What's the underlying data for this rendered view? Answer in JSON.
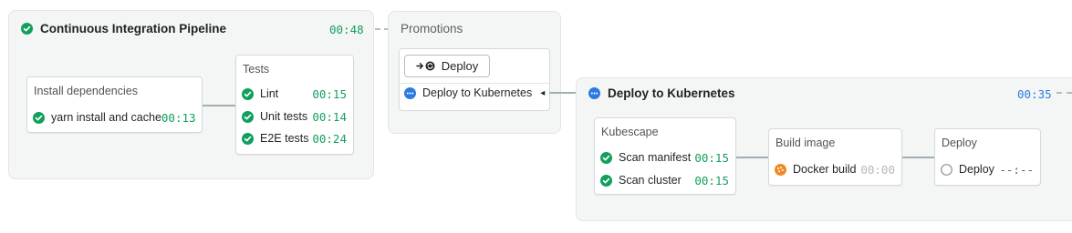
{
  "ci": {
    "title": "Continuous Integration Pipeline",
    "time": "00:48",
    "status_icon": "check-circle-icon",
    "blocks": {
      "install": {
        "title": "Install dependencies",
        "jobs": [
          {
            "name": "yarn install and cache",
            "time": "00:13"
          }
        ]
      },
      "tests": {
        "title": "Tests",
        "jobs": [
          {
            "name": "Lint",
            "time": "00:15"
          },
          {
            "name": "Unit tests",
            "time": "00:14"
          },
          {
            "name": "E2E tests",
            "time": "00:24"
          }
        ]
      }
    }
  },
  "promotions": {
    "title": "Promotions",
    "button_label": "Deploy",
    "target_label": "Deploy to Kubernetes",
    "arrow_glyph": "◂"
  },
  "deploy": {
    "title": "Deploy to Kubernetes",
    "time": "00:35",
    "status_icon": "running-circle-icon",
    "blocks": {
      "kubescape": {
        "title": "Kubescape",
        "jobs": [
          {
            "name": "Scan manifest",
            "time": "00:15"
          },
          {
            "name": "Scan cluster",
            "time": "00:15"
          }
        ]
      },
      "build": {
        "title": "Build image",
        "jobs": [
          {
            "name": "Docker build",
            "time": "00:00"
          }
        ]
      },
      "deployblock": {
        "title": "Deploy",
        "jobs": [
          {
            "name": "Deploy",
            "time": "--:--"
          }
        ]
      }
    }
  },
  "colors": {
    "passed": "#129f5d",
    "running": "#2d7ae0",
    "queued": "#f08a24",
    "connector": "#9fb0b5"
  }
}
